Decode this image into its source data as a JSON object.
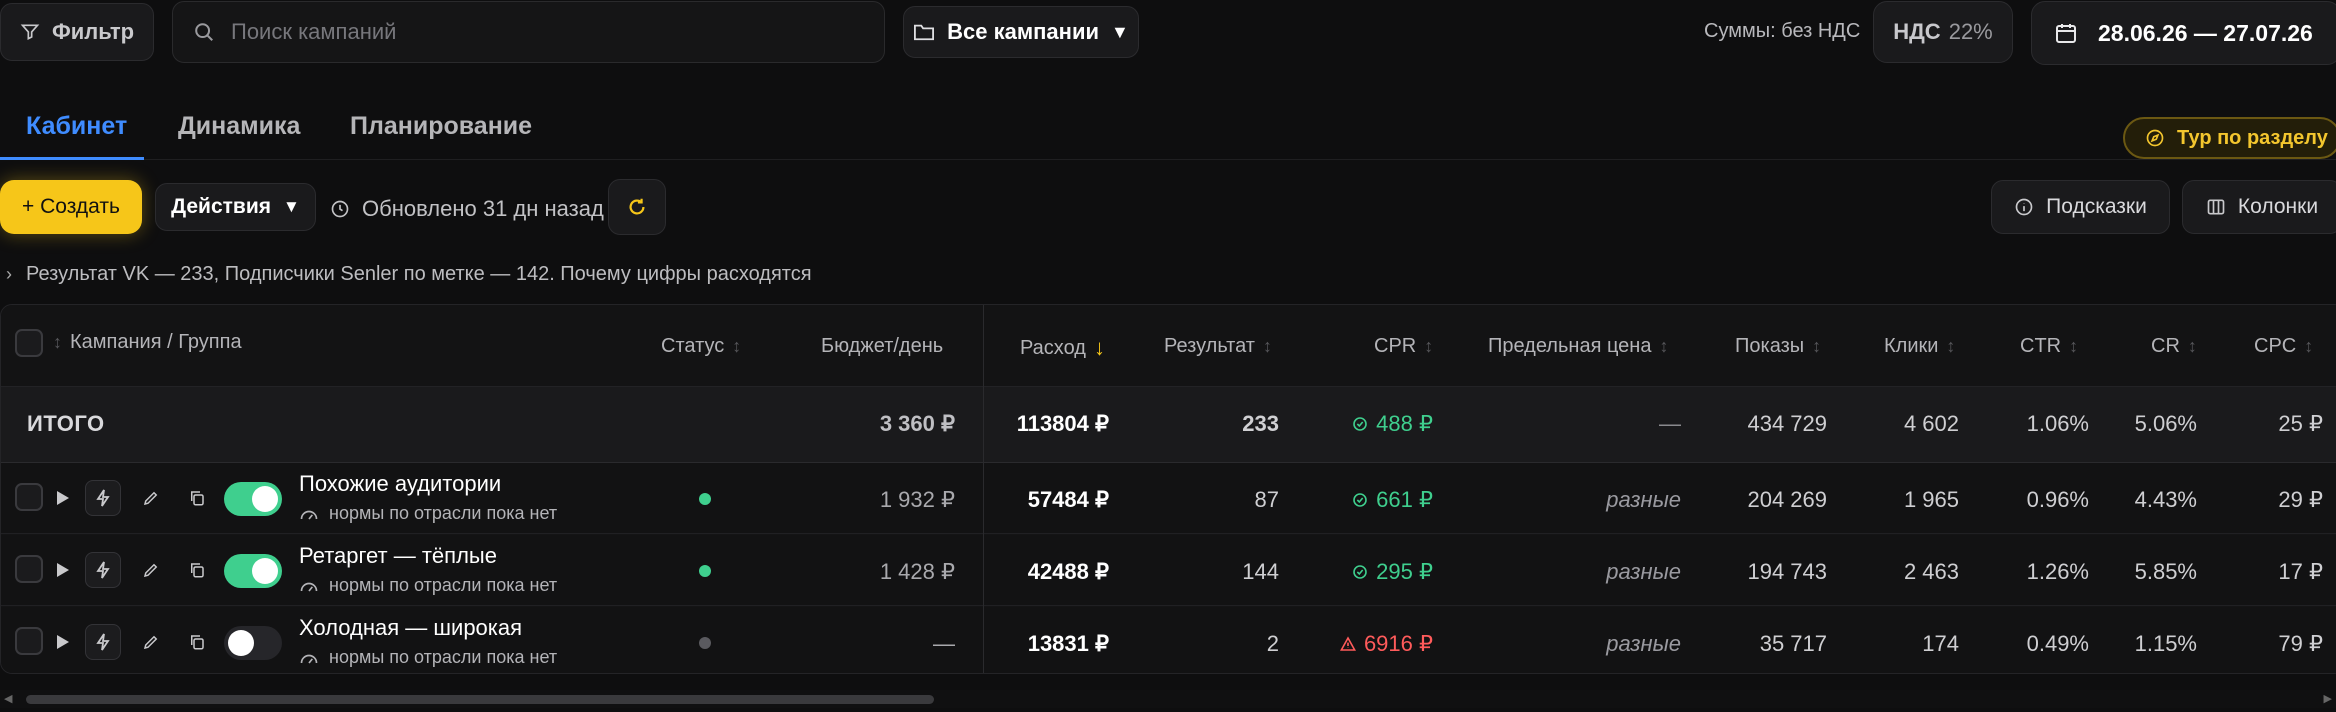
{
  "toolbar": {
    "filter_label": "Фильтр",
    "search_placeholder": "Поиск кампаний",
    "campaigns_label": "Все кампании",
    "sums_label": "Суммы: без НДС",
    "vat_prefix": "НДС",
    "vat_value": "22%",
    "date_range": "28.06.26 — 27.07.26"
  },
  "tabs": [
    {
      "label": "Кабинет",
      "active": true
    },
    {
      "label": "Динамика",
      "active": false
    },
    {
      "label": "Планирование",
      "active": false
    }
  ],
  "tour_label": "Тур по разделу",
  "actions_bar": {
    "create_label": "+ Создать",
    "actions_label": "Действия",
    "updated_label": "Обновлено 31 дн назад",
    "hints_label": "Подсказки",
    "columns_label": "Колонки"
  },
  "result_note": "Результат VK — 233, Подписчики Senler по метке — 142. Почему цифры расходятся",
  "table": {
    "headers": {
      "campaign": "Кампания / Группа",
      "status": "Статус",
      "budget": "Бюджет/день",
      "spend": "Расход",
      "result": "Результат",
      "cpr": "CPR",
      "limit_price": "Предельная цена",
      "impressions": "Показы",
      "clicks": "Клики",
      "ctr": "CTR",
      "cr": "CR",
      "cpc": "CPC"
    },
    "total": {
      "label": "ИТОГО",
      "budget": "3 360 ₽",
      "spend": "113804 ₽",
      "result": "233",
      "cpr": "488 ₽",
      "limit_price": "—",
      "impressions": "434 729",
      "clicks": "4 602",
      "ctr": "1.06%",
      "cr": "5.06%",
      "cpc": "25 ₽"
    },
    "rows": [
      {
        "name": "Похожие аудитории",
        "note": "нормы по отрасли пока нет",
        "enabled": true,
        "status_color": "#3fcf8e",
        "budget": "1 932 ₽",
        "spend": "57484 ₽",
        "result": "87",
        "cpr": "661 ₽",
        "cpr_state": "ok",
        "limit_price": "разные",
        "impressions": "204 269",
        "clicks": "1 965",
        "ctr": "0.96%",
        "cr": "4.43%",
        "cpc": "29 ₽"
      },
      {
        "name": "Ретаргет — тёплые",
        "note": "нормы по отрасли пока нет",
        "enabled": true,
        "status_color": "#3fcf8e",
        "budget": "1 428 ₽",
        "spend": "42488 ₽",
        "result": "144",
        "cpr": "295 ₽",
        "cpr_state": "ok",
        "limit_price": "разные",
        "impressions": "194 743",
        "clicks": "2 463",
        "ctr": "1.26%",
        "cr": "5.85%",
        "cpc": "17 ₽"
      },
      {
        "name": "Холодная — широкая",
        "note": "нормы по отрасли пока нет",
        "enabled": false,
        "status_color": "#5a5a5f",
        "budget": "—",
        "spend": "13831 ₽",
        "result": "2",
        "cpr": "6916 ₽",
        "cpr_state": "warning",
        "limit_price": "разные",
        "impressions": "35 717",
        "clicks": "174",
        "ctr": "0.49%",
        "cr": "1.15%",
        "cpc": "79 ₽"
      }
    ]
  },
  "colors": {
    "accent_blue": "#3f8cff",
    "accent_yellow": "#f6c619",
    "ok_green": "#3fcf8e",
    "warn_red": "#ff5b5b"
  }
}
